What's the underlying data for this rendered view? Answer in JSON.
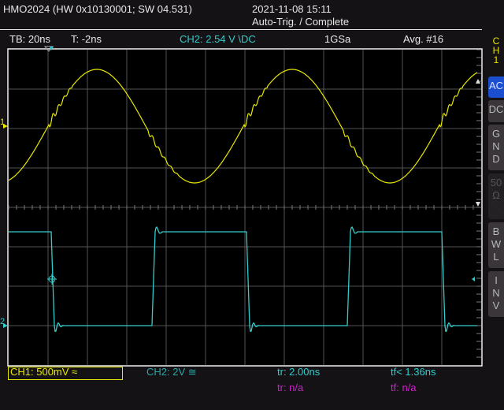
{
  "header": {
    "device": "HMO2024 (HW 0x10130001; SW 04.531)",
    "datetime": "2021-11-08 15:11",
    "status": "Auto-Trig. / Complete"
  },
  "infobar": {
    "timebase": "TB: 20ns",
    "trigger_time": "T: -2ns",
    "trigger_level": "CH2: 2.54 V \\DC",
    "sample_rate": "1GSa",
    "acquisition": "Avg. #16"
  },
  "markers": {
    "ch1": "1",
    "ch2": "2"
  },
  "side_menu": {
    "channel": [
      "C",
      "H",
      "1"
    ],
    "buttons": [
      {
        "label": "AC",
        "active": true
      },
      {
        "label": "DC",
        "active": false
      },
      {
        "label": "G\nN\nD",
        "active": false
      },
      {
        "label": "50\nΩ",
        "active": false,
        "disabled": true
      },
      {
        "label": "B\nW\nL",
        "active": false
      },
      {
        "label": "I\nN\nV",
        "active": false
      }
    ]
  },
  "footer": {
    "ch1_scale": "CH1: 500mV ≈",
    "ch2_scale": "CH2: 2V ≅",
    "ch2_rise": "tr: 2.00ns",
    "ch2_fall": "tf< 1.36ns",
    "math_rise": "tr: n/a",
    "math_fall": "tf: n/a"
  },
  "colors": {
    "ch1": "#e8e800",
    "ch2": "#33cccc",
    "math": "#cc22cc",
    "active": "#1c4fd0"
  }
}
